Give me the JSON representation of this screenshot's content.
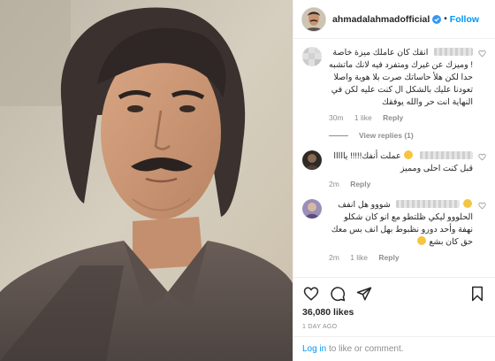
{
  "post": {
    "username": "ahmadalahmadofficial",
    "separator": "•",
    "follow_label": "Follow",
    "photo_icon": "portrait-photo",
    "verified_icon": "verified-badge-icon"
  },
  "comments": [
    {
      "text": "انقك كان عاملك ميزة خاصة ! وميزك عن غيرك ومتفرد فيه لانك ماتشبه حدا لكن هلأ حاساتك صرت بلا هوية واصلا تعودنا عليك بالشكل ال كنت عليه لكن في النهاية انت حر والله يوفقك",
      "time": "30m",
      "likes": "1 like",
      "reply": "Reply"
    },
    {
      "text": "عملت أنفك!!!!! يااااا قبل كنت احلى ومميز",
      "time": "2m",
      "reply": "Reply"
    },
    {
      "text": "شووو هل انفف الحلووو ليكي ظلتطو مع انو كان شكلو نهفة وأحد دورو نظبوط بهل انف بس معك حق كان بشع",
      "time": "2m",
      "likes": "1 like",
      "reply": "Reply"
    }
  ],
  "view_replies": "View replies (1)",
  "likes_count": "36,080 likes",
  "timestamp": "1 DAY AGO",
  "login": {
    "link_text": "Log in",
    "rest_text": " to like or comment."
  },
  "colors": {
    "accent": "#0095f6",
    "muted": "#8e8e8e",
    "text": "#262626"
  }
}
